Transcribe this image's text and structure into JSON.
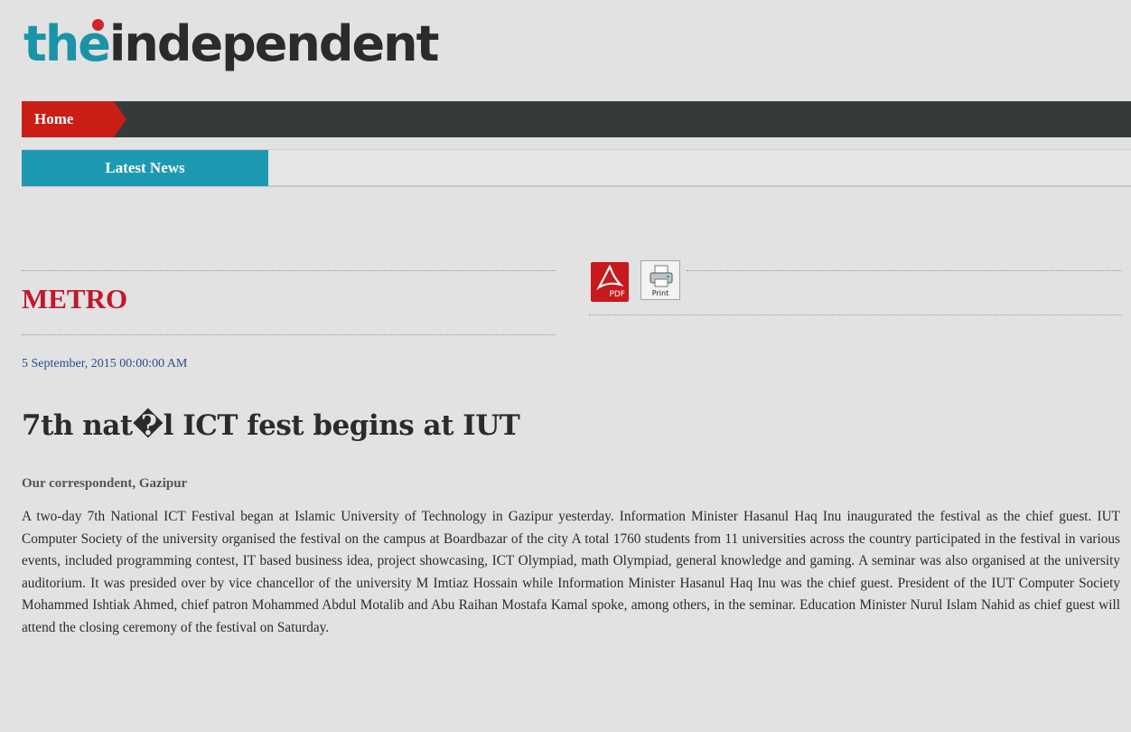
{
  "logo": {
    "part1": "the",
    "part2": "independent"
  },
  "nav": {
    "home_label": "Home"
  },
  "subnav": {
    "latest_label": "Latest News"
  },
  "article": {
    "section": "METRO",
    "date": "5 September, 2015 00:00:00 AM",
    "headline": "7th nat�l ICT fest begins at IUT",
    "byline": "Our correspondent, Gazipur",
    "body": "A two-day 7th National ICT Festival began at Islamic University of Technology in Gazipur yesterday. Information Minister Hasanul Haq Inu inaugurated the festival as the chief guest. IUT Computer Society of the university organised the festival on the campus at Boardbazar of the city A total 1760 students from 11 universities across the country participated in the festival in various events, included programming contest, IT based business idea, project showcasing, ICT Olympiad, math Olympiad, general knowledge and gaming. A seminar was also organised at the university auditorium. It was presided over by vice chancellor of the university M Imtiaz Hossain while Information Minister Hasanul Haq Inu was the chief guest.  President of the IUT Computer Society Mohammed Ishtiak Ahmed, chief patron Mohammed Abdul Motalib and Abu Raihan Mostafa Kamal spoke, among others, in the seminar. Education Minister Nurul Islam Nahid as chief guest will attend the closing ceremony of the festival on Saturday."
  },
  "tools": {
    "pdf_label": "PDF",
    "print_label": "Print",
    "pdf_icon": "pdf-icon",
    "print_icon": "printer-icon"
  },
  "colors": {
    "brand_teal": "#1a93a8",
    "brand_red": "#c81e15",
    "section_red": "#c0182c",
    "nav_dark": "#363a3b",
    "date_blue": "#2b4c8a"
  }
}
